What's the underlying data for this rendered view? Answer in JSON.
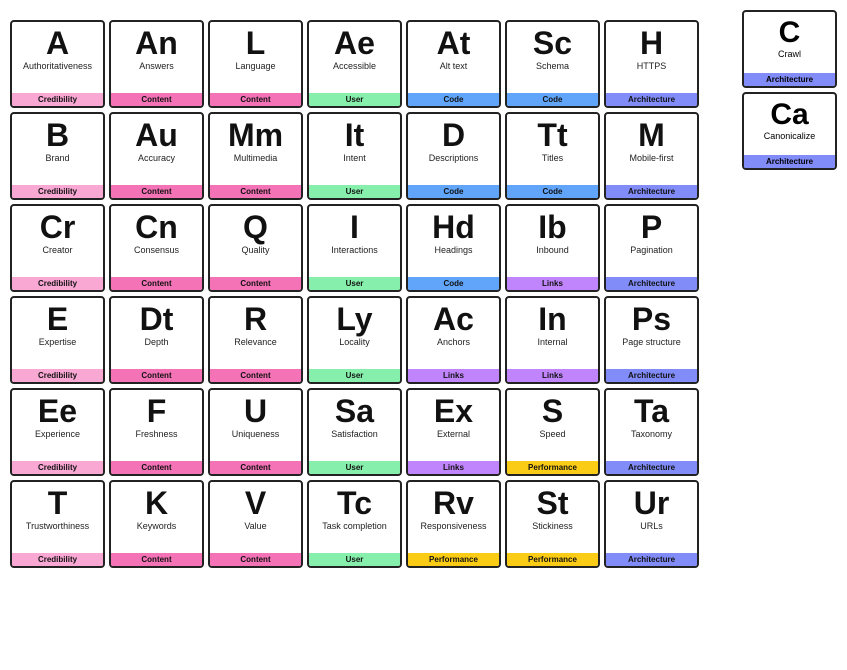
{
  "topCells": [
    {
      "symbol": "C",
      "name": "Crawl",
      "badge": "Architecture",
      "badgeClass": "badge-architecture"
    },
    {
      "symbol": "Ca",
      "name": "Canonicalize",
      "badge": "Architecture",
      "badgeClass": "badge-architecture"
    }
  ],
  "rows": [
    [
      {
        "symbol": "A",
        "name": "Authoritativeness",
        "badge": "Credibility",
        "badgeClass": "badge-credibility"
      },
      {
        "symbol": "An",
        "name": "Answers",
        "badge": "Content",
        "badgeClass": "badge-content"
      },
      {
        "symbol": "L",
        "name": "Language",
        "badge": "Content",
        "badgeClass": "badge-content"
      },
      {
        "symbol": "Ae",
        "name": "Accessible",
        "badge": "User",
        "badgeClass": "badge-user"
      },
      {
        "symbol": "At",
        "name": "Alt text",
        "badge": "Code",
        "badgeClass": "badge-code"
      },
      {
        "symbol": "Sc",
        "name": "Schema",
        "badge": "Code",
        "badgeClass": "badge-code"
      },
      {
        "symbol": "H",
        "name": "HTTPS",
        "badge": "Architecture",
        "badgeClass": "badge-architecture"
      }
    ],
    [
      {
        "symbol": "B",
        "name": "Brand",
        "badge": "Credibility",
        "badgeClass": "badge-credibility"
      },
      {
        "symbol": "Au",
        "name": "Accuracy",
        "badge": "Content",
        "badgeClass": "badge-content"
      },
      {
        "symbol": "Mm",
        "name": "Multimedia",
        "badge": "Content",
        "badgeClass": "badge-content"
      },
      {
        "symbol": "It",
        "name": "Intent",
        "badge": "User",
        "badgeClass": "badge-user"
      },
      {
        "symbol": "D",
        "name": "Descriptions",
        "badge": "Code",
        "badgeClass": "badge-code"
      },
      {
        "symbol": "Tt",
        "name": "Titles",
        "badge": "Code",
        "badgeClass": "badge-code"
      },
      {
        "symbol": "M",
        "name": "Mobile-first",
        "badge": "Architecture",
        "badgeClass": "badge-architecture"
      }
    ],
    [
      {
        "symbol": "Cr",
        "name": "Creator",
        "badge": "Credibility",
        "badgeClass": "badge-credibility"
      },
      {
        "symbol": "Cn",
        "name": "Consensus",
        "badge": "Content",
        "badgeClass": "badge-content"
      },
      {
        "symbol": "Q",
        "name": "Quality",
        "badge": "Content",
        "badgeClass": "badge-content"
      },
      {
        "symbol": "I",
        "name": "Interactions",
        "badge": "User",
        "badgeClass": "badge-user"
      },
      {
        "symbol": "Hd",
        "name": "Headings",
        "badge": "Code",
        "badgeClass": "badge-code"
      },
      {
        "symbol": "Ib",
        "name": "Inbound",
        "badge": "Links",
        "badgeClass": "badge-links"
      },
      {
        "symbol": "P",
        "name": "Pagination",
        "badge": "Architecture",
        "badgeClass": "badge-architecture"
      }
    ],
    [
      {
        "symbol": "E",
        "name": "Expertise",
        "badge": "Credibility",
        "badgeClass": "badge-credibility"
      },
      {
        "symbol": "Dt",
        "name": "Depth",
        "badge": "Content",
        "badgeClass": "badge-content"
      },
      {
        "symbol": "R",
        "name": "Relevance",
        "badge": "Content",
        "badgeClass": "badge-content"
      },
      {
        "symbol": "Ly",
        "name": "Locality",
        "badge": "User",
        "badgeClass": "badge-user"
      },
      {
        "symbol": "Ac",
        "name": "Anchors",
        "badge": "Links",
        "badgeClass": "badge-links"
      },
      {
        "symbol": "In",
        "name": "Internal",
        "badge": "Links",
        "badgeClass": "badge-links"
      },
      {
        "symbol": "Ps",
        "name": "Page structure",
        "badge": "Architecture",
        "badgeClass": "badge-architecture"
      }
    ],
    [
      {
        "symbol": "Ee",
        "name": "Experience",
        "badge": "Credibility",
        "badgeClass": "badge-credibility"
      },
      {
        "symbol": "F",
        "name": "Freshness",
        "badge": "Content",
        "badgeClass": "badge-content"
      },
      {
        "symbol": "U",
        "name": "Uniqueness",
        "badge": "Content",
        "badgeClass": "badge-content"
      },
      {
        "symbol": "Sa",
        "name": "Satisfaction",
        "badge": "User",
        "badgeClass": "badge-user"
      },
      {
        "symbol": "Ex",
        "name": "External",
        "badge": "Links",
        "badgeClass": "badge-links"
      },
      {
        "symbol": "S",
        "name": "Speed",
        "badge": "Performance",
        "badgeClass": "badge-performance"
      },
      {
        "symbol": "Ta",
        "name": "Taxonomy",
        "badge": "Architecture",
        "badgeClass": "badge-architecture"
      }
    ],
    [
      {
        "symbol": "T",
        "name": "Trustworthiness",
        "badge": "Credibility",
        "badgeClass": "badge-credibility"
      },
      {
        "symbol": "K",
        "name": "Keywords",
        "badge": "Content",
        "badgeClass": "badge-content"
      },
      {
        "symbol": "V",
        "name": "Value",
        "badge": "Content",
        "badgeClass": "badge-content"
      },
      {
        "symbol": "Tc",
        "name": "Task completion",
        "badge": "User",
        "badgeClass": "badge-user"
      },
      {
        "symbol": "Rv",
        "name": "Responsiveness",
        "badge": "Performance",
        "badgeClass": "badge-performance"
      },
      {
        "symbol": "St",
        "name": "Stickiness",
        "badge": "Performance",
        "badgeClass": "badge-performance"
      },
      {
        "symbol": "Ur",
        "name": "URLs",
        "badge": "Architecture",
        "badgeClass": "badge-architecture"
      }
    ]
  ]
}
